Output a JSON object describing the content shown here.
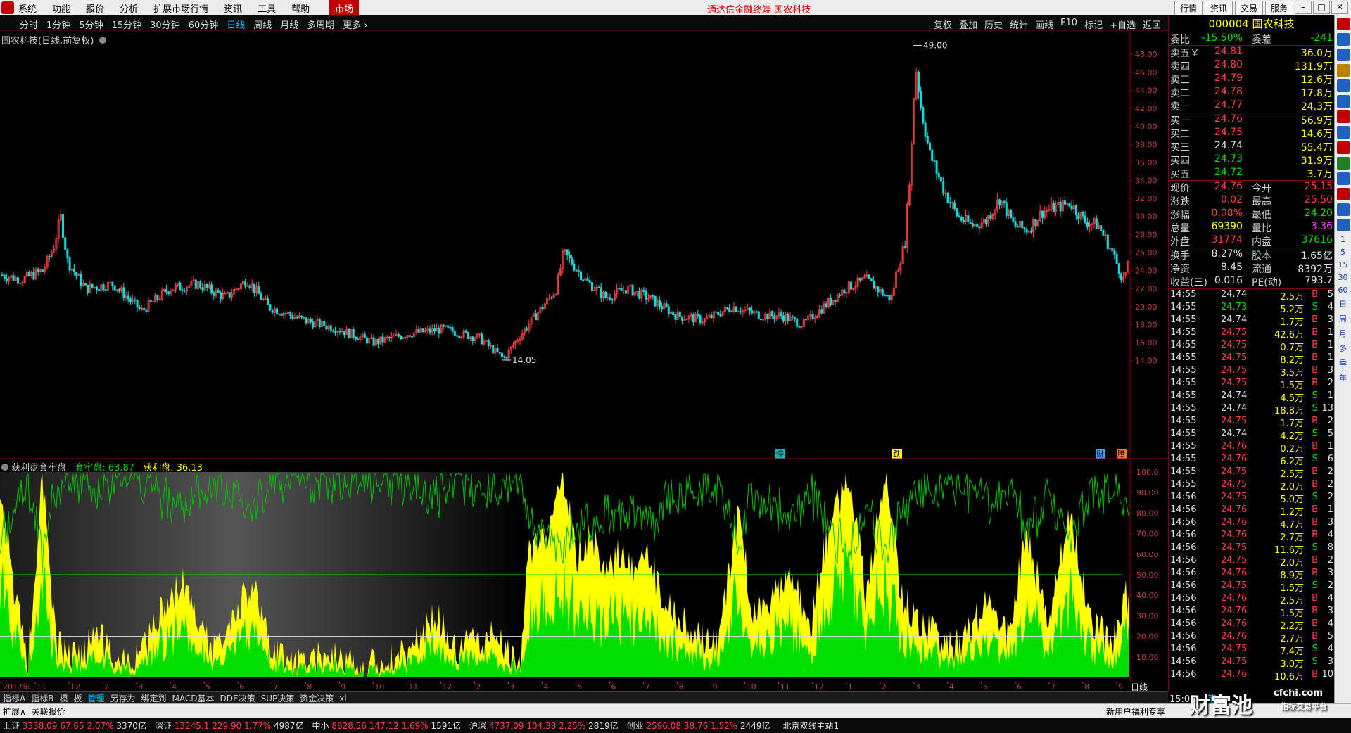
{
  "menubar": {
    "items": [
      "系统",
      "功能",
      "报价",
      "分析",
      "扩展市场行情",
      "资讯",
      "工具",
      "帮助"
    ],
    "market_label": "市场",
    "center_title": "通达信金融终端  国农科技",
    "right_buttons": [
      "行情",
      "资讯",
      "交易",
      "服务"
    ]
  },
  "toolbar": {
    "periods": [
      "分时",
      "1分钟",
      "5分钟",
      "15分钟",
      "30分钟",
      "60分钟",
      "日线",
      "周线",
      "月线",
      "多周期",
      "更多 ›"
    ],
    "active_period": "日线",
    "tools": [
      "复权",
      "叠加",
      "历史",
      "统计",
      "画线",
      "F10",
      "标记",
      "+自选",
      "返回"
    ]
  },
  "main_chart": {
    "title": "国农科技(日线,前复权)",
    "y_ticks": [
      "48.00",
      "46.00",
      "44.00",
      "42.00",
      "40.00",
      "38.00",
      "36.00",
      "34.00",
      "32.00",
      "30.00",
      "28.00",
      "26.00",
      "24.00",
      "22.00",
      "20.00",
      "18.00",
      "16.00",
      "14.00"
    ],
    "high_label": "49.00",
    "low_label": "14.05",
    "markers": [
      "停",
      "跌",
      "财",
      "腾"
    ]
  },
  "indicator": {
    "name": "获利盘套牢盘",
    "trapped_label": "套牢盘",
    "trapped_value": "63.87",
    "profit_label": "获利盘",
    "profit_value": "36.13",
    "y_ticks": [
      "100.0",
      "90.00",
      "80.00",
      "70.00",
      "60.00",
      "50.00",
      "40.00",
      "30.00",
      "20.00",
      "10.00"
    ]
  },
  "xaxis": {
    "labels": [
      "2017年",
      "11",
      "12",
      "2",
      "3",
      "4",
      "5",
      "6",
      "7",
      "8",
      "9",
      "10",
      "11",
      "12",
      "2",
      "3",
      "4",
      "5",
      "6",
      "7",
      "8",
      "9",
      "10",
      "11",
      "12",
      "1",
      "2",
      "3",
      "4",
      "5",
      "6",
      "7",
      "8",
      "9"
    ],
    "period_label": "日线"
  },
  "bottom_tabs": [
    "指标A",
    "指标B",
    "模",
    "板",
    "管理",
    "另存为",
    "绑定到",
    "MACD基本",
    "DDE决策",
    "SUP决策",
    "资金决策",
    "xl"
  ],
  "active_tab": "管理",
  "ext_bar": {
    "left": [
      "扩展∧",
      "关联报价"
    ],
    "right_msg": "新用户福利专享"
  },
  "ticker": [
    {
      "name": "上证",
      "value": "3338.09",
      "chg": "67.65",
      "pct": "2.07%",
      "amt": "3370亿"
    },
    {
      "name": "深证",
      "value": "13245.1",
      "chg": "229.90",
      "pct": "1.77%",
      "amt": "4987亿"
    },
    {
      "name": "中小",
      "value": "8828.56",
      "chg": "147.12",
      "pct": "1.69%",
      "amt": "1591亿"
    },
    {
      "name": "沪深",
      "value": "4737.09",
      "chg": "104.38",
      "pct": "2.25%",
      "amt": "2819亿"
    },
    {
      "name": "创业",
      "value": "2596.08",
      "chg": "38.76",
      "pct": "1.52%",
      "amt": "2449亿"
    }
  ],
  "server": "北京双线主站1",
  "quote": {
    "code": "000004",
    "name": "国农科技",
    "weibi_label": "委比",
    "weibi": "-15.50%",
    "weicha_label": "委差",
    "weicha": "-241",
    "asks": [
      {
        "label": "卖五￥",
        "price": "24.81",
        "vol": "36.0万"
      },
      {
        "label": "卖四",
        "price": "24.80",
        "vol": "131.9万"
      },
      {
        "label": "卖三",
        "price": "24.79",
        "vol": "12.6万"
      },
      {
        "label": "卖二",
        "price": "24.78",
        "vol": "17.8万"
      },
      {
        "label": "卖一",
        "price": "24.77",
        "vol": "24.3万"
      }
    ],
    "bids": [
      {
        "label": "买一",
        "price": "24.76",
        "vol": "56.9万"
      },
      {
        "label": "买二",
        "price": "24.75",
        "vol": "14.6万"
      },
      {
        "label": "买三",
        "price": "24.74",
        "vol": "55.4万"
      },
      {
        "label": "买四",
        "price": "24.73",
        "vol": "31.9万"
      },
      {
        "label": "买五",
        "price": "24.72",
        "vol": "3.7万"
      }
    ],
    "stats": [
      {
        "l1": "现价",
        "v1": "24.76",
        "c1": "red",
        "l2": "今开",
        "v2": "25.15",
        "c2": "red"
      },
      {
        "l1": "涨跌",
        "v1": "0.02",
        "c1": "red",
        "l2": "最高",
        "v2": "25.50",
        "c2": "red"
      },
      {
        "l1": "涨幅",
        "v1": "0.08%",
        "c1": "red",
        "l2": "最低",
        "v2": "24.20",
        "c2": "green"
      },
      {
        "l1": "总量",
        "v1": "69390",
        "c1": "yellow",
        "l2": "量比",
        "v2": "3.36",
        "c2": "magenta"
      },
      {
        "l1": "外盘",
        "v1": "31774",
        "c1": "red",
        "l2": "内盘",
        "v2": "37616",
        "c2": "green"
      }
    ],
    "fund": [
      {
        "l1": "换手",
        "v1": "8.27%",
        "l2": "股本",
        "v2": "1.65亿"
      },
      {
        "l1": "净资",
        "v1": "8.45",
        "l2": "流通",
        "v2": "8392万"
      },
      {
        "l1": "收益(三)",
        "v1": "0.016",
        "l2": "PE(动)",
        "v2": "793.7"
      }
    ],
    "ticks": [
      {
        "time": "14:55",
        "price": "24.74",
        "pc": "white",
        "vol": "2.5万",
        "bs": "B",
        "n": "5"
      },
      {
        "time": "14:55",
        "price": "24.73",
        "pc": "green",
        "vol": "5.2万",
        "bs": "S",
        "n": "4"
      },
      {
        "time": "14:55",
        "price": "24.74",
        "pc": "white",
        "vol": "1.7万",
        "bs": "B",
        "n": "3"
      },
      {
        "time": "14:55",
        "price": "24.75",
        "pc": "red",
        "vol": "42.6万",
        "bs": "B",
        "n": "1"
      },
      {
        "time": "14:55",
        "price": "24.75",
        "pc": "red",
        "vol": "0.7万",
        "bs": "B",
        "n": "1"
      },
      {
        "time": "14:55",
        "price": "24.75",
        "pc": "red",
        "vol": "8.2万",
        "bs": "B",
        "n": "1"
      },
      {
        "time": "14:55",
        "price": "24.75",
        "pc": "red",
        "vol": "3.5万",
        "bs": "B",
        "n": "3"
      },
      {
        "time": "14:55",
        "price": "24.75",
        "pc": "red",
        "vol": "1.5万",
        "bs": "B",
        "n": "2"
      },
      {
        "time": "14:55",
        "price": "24.74",
        "pc": "white",
        "vol": "4.5万",
        "bs": "S",
        "n": "1"
      },
      {
        "time": "14:55",
        "price": "24.74",
        "pc": "white",
        "vol": "18.8万",
        "bs": "S",
        "n": "13"
      },
      {
        "time": "14:55",
        "price": "24.75",
        "pc": "red",
        "vol": "1.7万",
        "bs": "B",
        "n": "2"
      },
      {
        "time": "14:55",
        "price": "24.74",
        "pc": "white",
        "vol": "4.2万",
        "bs": "S",
        "n": "5"
      },
      {
        "time": "14:55",
        "price": "24.76",
        "pc": "red",
        "vol": "0.2万",
        "bs": "B",
        "n": "1"
      },
      {
        "time": "14:55",
        "price": "24.76",
        "pc": "red",
        "vol": "6.2万",
        "bs": "S",
        "n": "6"
      },
      {
        "time": "14:55",
        "price": "24.75",
        "pc": "red",
        "vol": "2.5万",
        "bs": "B",
        "n": "2"
      },
      {
        "time": "14:55",
        "price": "24.75",
        "pc": "red",
        "vol": "2.0万",
        "bs": "B",
        "n": "2"
      },
      {
        "time": "14:56",
        "price": "24.75",
        "pc": "red",
        "vol": "5.0万",
        "bs": "S",
        "n": "2"
      },
      {
        "time": "14:56",
        "price": "24.76",
        "pc": "red",
        "vol": "1.2万",
        "bs": "B",
        "n": "1"
      },
      {
        "time": "14:56",
        "price": "24.76",
        "pc": "red",
        "vol": "4.7万",
        "bs": "B",
        "n": "3"
      },
      {
        "time": "14:56",
        "price": "24.76",
        "pc": "red",
        "vol": "2.7万",
        "bs": "B",
        "n": "4"
      },
      {
        "time": "14:56",
        "price": "24.75",
        "pc": "red",
        "vol": "11.6万",
        "bs": "S",
        "n": "8"
      },
      {
        "time": "14:56",
        "price": "24.75",
        "pc": "red",
        "vol": "2.0万",
        "bs": "B",
        "n": "2"
      },
      {
        "time": "14:56",
        "price": "24.76",
        "pc": "red",
        "vol": "8.9万",
        "bs": "B",
        "n": "3"
      },
      {
        "time": "14:56",
        "price": "24.75",
        "pc": "red",
        "vol": "1.5万",
        "bs": "S",
        "n": "2"
      },
      {
        "time": "14:56",
        "price": "24.76",
        "pc": "red",
        "vol": "2.5万",
        "bs": "B",
        "n": "4"
      },
      {
        "time": "14:56",
        "price": "24.76",
        "pc": "red",
        "vol": "1.5万",
        "bs": "B",
        "n": "3"
      },
      {
        "time": "14:56",
        "price": "24.76",
        "pc": "red",
        "vol": "2.2万",
        "bs": "B",
        "n": "4"
      },
      {
        "time": "14:56",
        "price": "24.76",
        "pc": "red",
        "vol": "2.7万",
        "bs": "B",
        "n": "5"
      },
      {
        "time": "14:56",
        "price": "24.75",
        "pc": "red",
        "vol": "7.4万",
        "bs": "S",
        "n": "4"
      },
      {
        "time": "14:56",
        "price": "24.75",
        "pc": "red",
        "vol": "3.0万",
        "bs": "S",
        "n": "3"
      },
      {
        "time": "14:56",
        "price": "24.76",
        "pc": "red",
        "vol": "10.6万",
        "bs": "B",
        "n": "10"
      }
    ],
    "footer_time": "15:00",
    "footer_mode": "笔"
  },
  "side_strip": [
    "1",
    "5",
    "15",
    "30",
    "60",
    "日",
    "周",
    "月",
    "多",
    "季",
    "年"
  ],
  "overlay": {
    "logo": "财富池",
    "site": "cfchi.com",
    "tag": "指标交易平台"
  },
  "colors": {
    "up": "#ff4040",
    "down": "#00e0e0",
    "profit": "#ffff00",
    "trapped": "#00e000"
  }
}
